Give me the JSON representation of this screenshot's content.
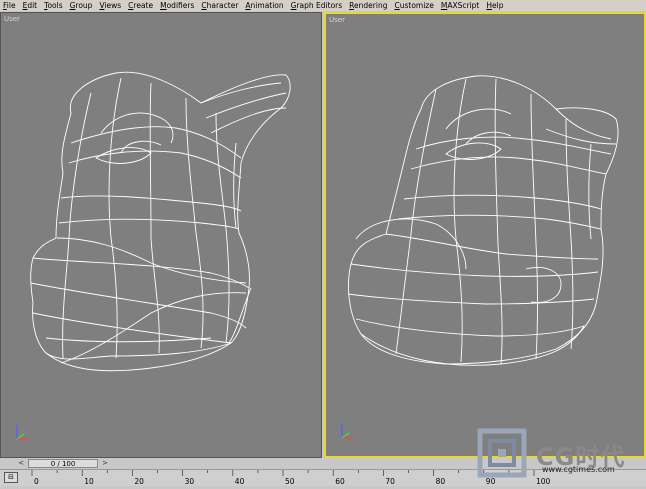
{
  "menu": [
    "File",
    "Edit",
    "Tools",
    "Group",
    "Views",
    "Create",
    "Modifiers",
    "Character",
    "Animation",
    "Graph Editors",
    "Rendering",
    "Customize",
    "MAXScript",
    "Help"
  ],
  "viewports": {
    "left": {
      "label": "User"
    },
    "right": {
      "label": "User"
    }
  },
  "time_slider": {
    "text": "0 / 100"
  },
  "ruler": {
    "ticks": [
      "0",
      "10",
      "20",
      "30",
      "40",
      "50",
      "60",
      "70",
      "80",
      "90",
      "100"
    ]
  },
  "watermark": {
    "logo_text": "CG时代",
    "sub_text": "www.cgtimes.com"
  },
  "colors": {
    "active_viewport_border": "#e8d830",
    "viewport_bg": "#7f7f7f",
    "wire": "#ffffff"
  }
}
